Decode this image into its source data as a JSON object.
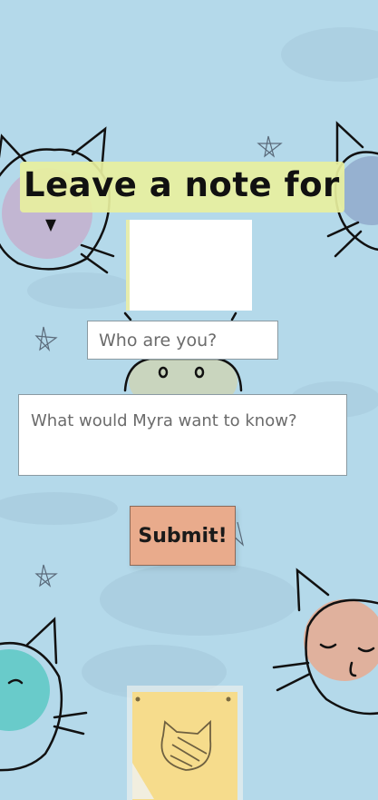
{
  "page": {
    "heading": "Leave a note for",
    "name_placeholder": "Who are you?",
    "question_placeholder": "What would Myra want to know?",
    "submit_label": "Submit!"
  },
  "colors": {
    "background": "#b4d9ea",
    "title_highlight": "#e8f09e",
    "submit_button": "#e9ab8c",
    "sticky_note": "#f6dc8c"
  },
  "icons": [
    "cat-doodle-icon",
    "star-doodle-icon",
    "sticky-note-icon"
  ]
}
